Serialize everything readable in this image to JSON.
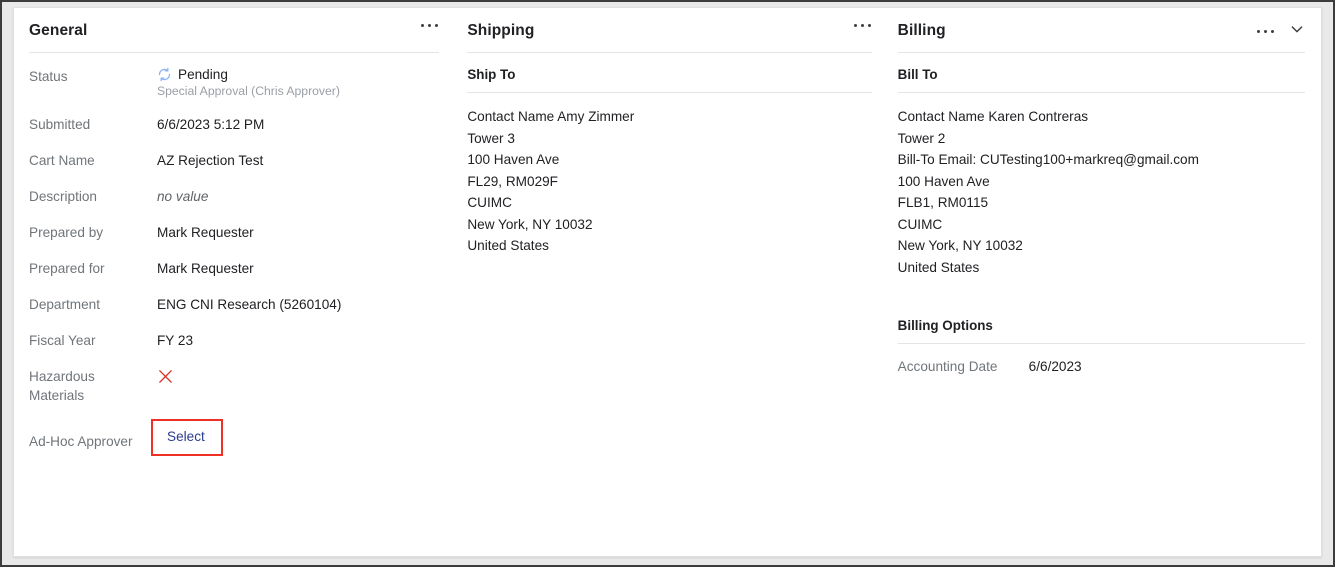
{
  "sections": {
    "general": {
      "title": "General",
      "kebab_icon": "ellipsis-horizontal-icon",
      "rows": [
        {
          "label": "Status",
          "value": "Pending",
          "sub": "Special Approval (Chris Approver)",
          "icon": "sync-refresh-icon",
          "icon_color": "#8ab4f8"
        },
        {
          "label": "Submitted",
          "value": "6/6/2023 5:12 PM"
        },
        {
          "label": "Cart Name",
          "value": "AZ Rejection Test"
        },
        {
          "label": "Description",
          "value": "no value",
          "style": "muted-italic"
        },
        {
          "label": "Prepared by",
          "value": "Mark Requester"
        },
        {
          "label": "Prepared for",
          "value": "Mark Requester"
        },
        {
          "label": "Department",
          "value": "ENG CNI Research (5260104)"
        },
        {
          "label": "Fiscal Year",
          "value": "FY 23"
        },
        {
          "label": "Hazardous Materials",
          "label_line1": "Hazardous",
          "label_line2": "Materials",
          "value": "",
          "icon": "x-mark-icon",
          "icon_color": "#d93025"
        }
      ],
      "adhoc": {
        "label": "Ad-Hoc Approver",
        "link_label": "Select",
        "link_color": "#2b3b8f",
        "highlight_color": "#ee3124"
      }
    },
    "shipping": {
      "title": "Shipping",
      "kebab_icon": "ellipsis-horizontal-icon",
      "subhead": "Ship To",
      "address_lines": [
        "Contact Name Amy Zimmer",
        "Tower 3",
        "100 Haven Ave",
        "FL29, RM029F",
        "CUIMC",
        "New York, NY 10032",
        "United States"
      ]
    },
    "billing": {
      "title": "Billing",
      "kebab_icon": "ellipsis-horizontal-icon",
      "chevron_icon": "chevron-down-icon",
      "subhead": "Bill To",
      "address_lines": [
        "Contact Name Karen Contreras",
        "Tower 2",
        "Bill-To Email: CUTesting100+markreq@gmail.com",
        "100 Haven Ave",
        "FLB1, RM0115",
        "CUIMC",
        "New York, NY 10032",
        "United States"
      ],
      "options": {
        "subhead": "Billing Options",
        "rows": [
          {
            "label": "Accounting Date",
            "value": "6/6/2023"
          }
        ]
      }
    }
  }
}
